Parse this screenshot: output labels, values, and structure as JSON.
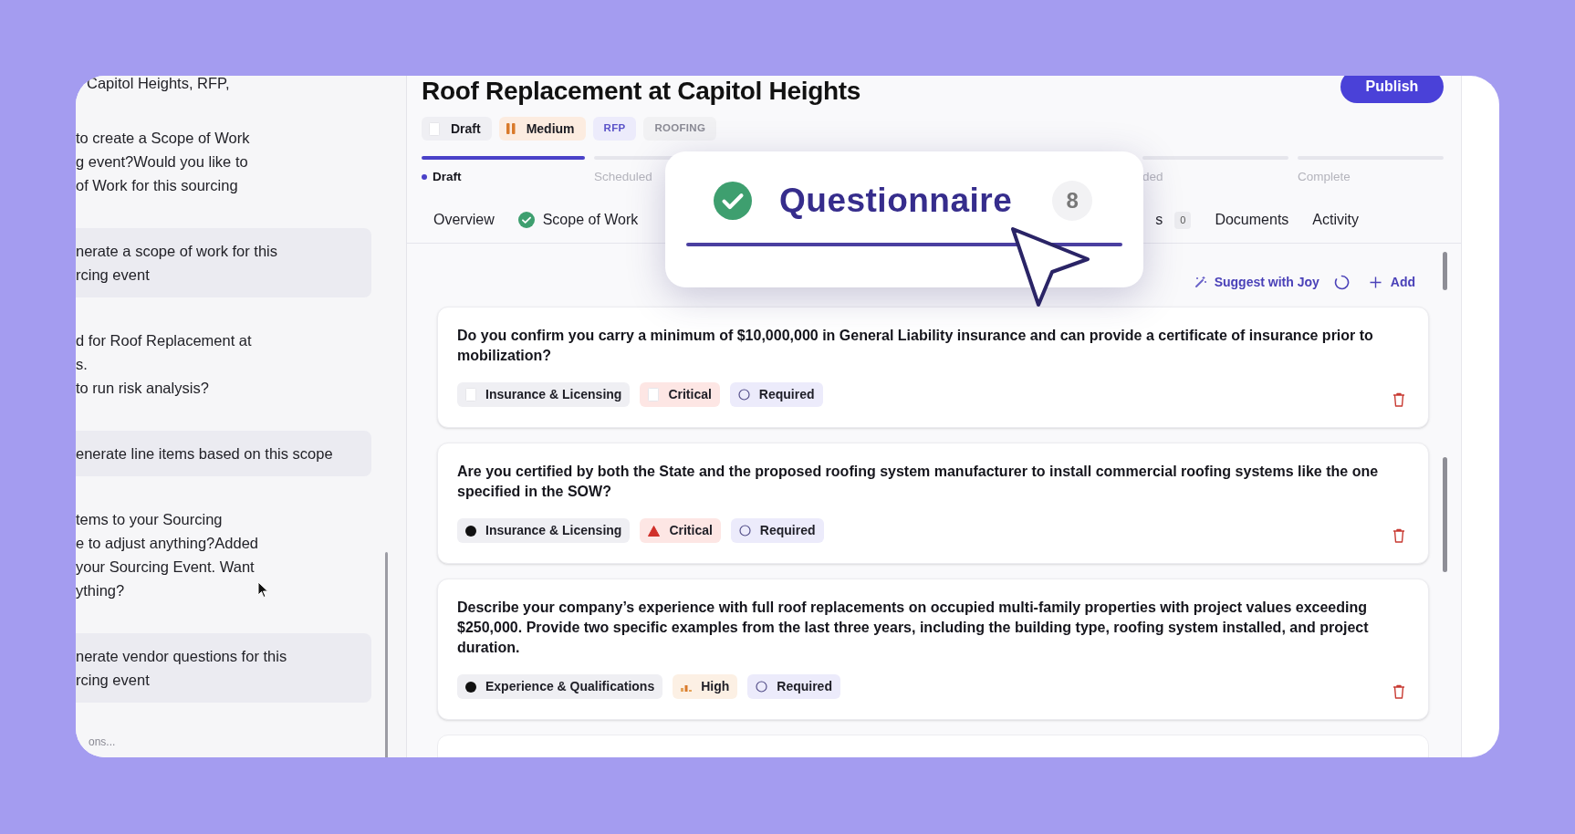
{
  "chat": {
    "messages": [
      {
        "kind": "text",
        "lines": [
          "Capitol Heights, RFP,"
        ]
      },
      {
        "kind": "text",
        "lines": [
          "to create a Scope of Work",
          "g event?Would you like to",
          "of Work for this sourcing"
        ]
      },
      {
        "kind": "bubble",
        "lines": [
          "nerate a scope of work for this",
          "rcing event"
        ]
      },
      {
        "kind": "text",
        "lines": [
          "d for Roof Replacement at",
          "s.",
          "to run risk analysis?"
        ]
      },
      {
        "kind": "bubble",
        "lines": [
          "enerate line items based on this scope"
        ]
      },
      {
        "kind": "text",
        "lines": [
          "tems to your Sourcing",
          "e to adjust anything?Added",
          "your Sourcing Event. Want",
          "ything?"
        ]
      },
      {
        "kind": "bubble",
        "lines": [
          "nerate vendor questions for this",
          "rcing event"
        ]
      }
    ],
    "footer": "ons..."
  },
  "header": {
    "title": "Roof Replacement at Capitol Heights",
    "publish": "Publish",
    "tags": [
      {
        "label": "Draft",
        "kind": "status",
        "color": "#efeff3"
      },
      {
        "label": "Medium",
        "kind": "medium",
        "color": "#fcece0"
      },
      {
        "label": "RFP",
        "kind": "type",
        "color": "#ecebfb"
      },
      {
        "label": "ROOFING",
        "kind": "trade",
        "color": "#f1f1f3"
      }
    ]
  },
  "stages": [
    {
      "label": "Draft",
      "selected": true
    },
    {
      "label": "Scheduled",
      "selected": false
    }
  ],
  "stages_end": [
    {
      "label": "ded",
      "selected": false
    },
    {
      "label": "Complete",
      "selected": false
    }
  ],
  "tabs": [
    {
      "label": "Overview",
      "done": false
    },
    {
      "label": "Scope of Work",
      "done": true
    }
  ],
  "tabs_end": [
    {
      "label": "s",
      "count": "0"
    },
    {
      "label": "Documents"
    },
    {
      "label": "Activity"
    }
  ],
  "callout": {
    "label": "Questionnaire",
    "count": "8",
    "done": true,
    "selected": true
  },
  "toolbar": {
    "suggest": "Suggest with Joy",
    "add": "Add"
  },
  "questions": [
    {
      "text": "Do you confirm you carry a minimum of $10,000,000 in General Liability insurance and can provide a certificate of insurance prior to mobilization?",
      "tags": [
        {
          "label": "Insurance & Licensing",
          "kind": "placeholder",
          "color": "#efeff3"
        },
        {
          "label": "Critical",
          "kind": "placeholder",
          "color": "#fde6e4"
        },
        {
          "label": "Required",
          "kind": "required",
          "color": "#ecebfb"
        }
      ]
    },
    {
      "text": "Are you certified by both the State and the proposed roofing system manufacturer to install commercial roofing systems like the one specified in the SOW?",
      "tags": [
        {
          "label": "Insurance & Licensing",
          "kind": "category",
          "color": "#efeff3"
        },
        {
          "label": "Critical",
          "kind": "critical",
          "color": "#fde6e4"
        },
        {
          "label": "Required",
          "kind": "required",
          "color": "#ecebfb"
        }
      ]
    },
    {
      "text": "Describe your company’s experience with full roof replacements on occupied multi-family properties with project values exceeding $250,000. Provide two specific examples from the last three years, including the building type, roofing system installed, and project duration.",
      "tags": [
        {
          "label": "Experience & Qualifications",
          "kind": "category",
          "color": "#efeff3"
        },
        {
          "label": "High",
          "kind": "high",
          "color": "#fcf0e4"
        },
        {
          "label": "Required",
          "kind": "required",
          "color": "#ecebfb"
        }
      ]
    }
  ]
}
